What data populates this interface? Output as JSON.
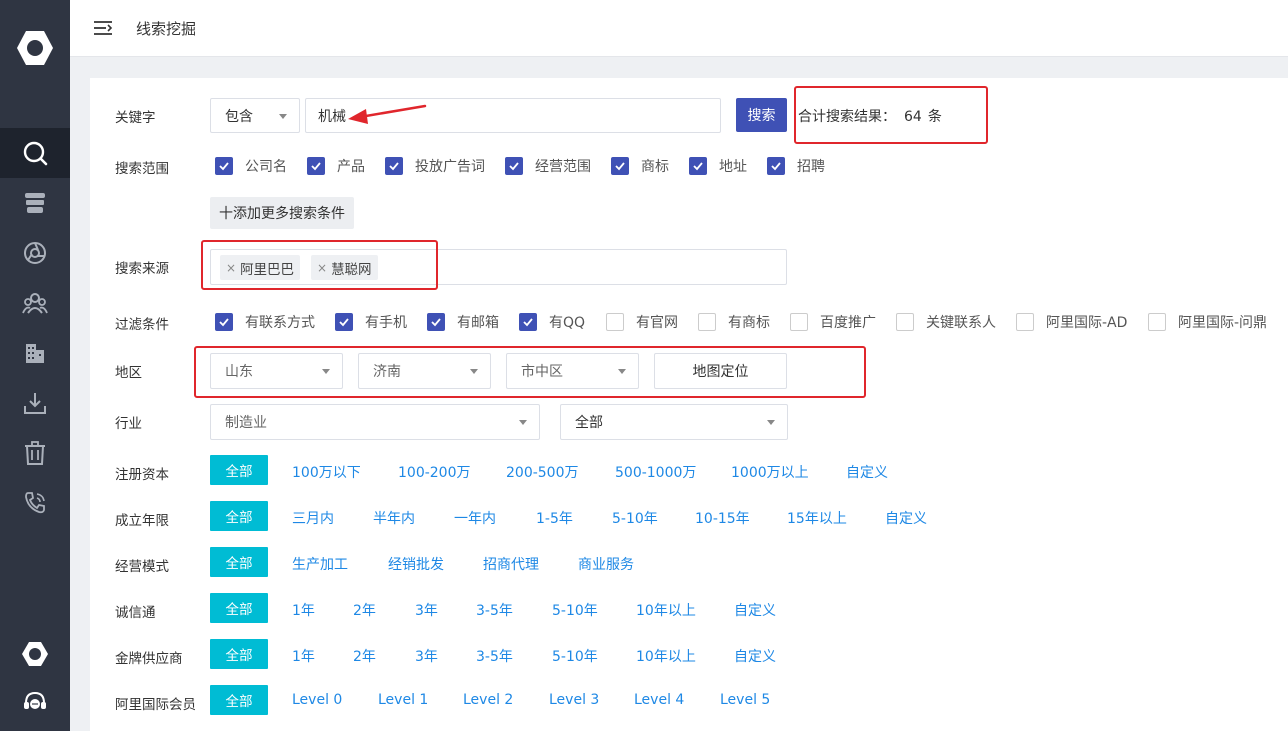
{
  "header": {
    "title": "线索挖掘"
  },
  "keyword": {
    "label": "关键字",
    "match_mode": "包含",
    "value": "机械",
    "search_label": "搜索",
    "result_prefix": "合计搜索结果：",
    "result_count": "64",
    "result_suffix": "条"
  },
  "scope": {
    "label": "搜索范围",
    "items": [
      "公司名",
      "产品",
      "投放广告词",
      "经营范围",
      "商标",
      "地址",
      "招聘"
    ],
    "add_more_label": "十添加更多搜索条件"
  },
  "source": {
    "label": "搜索来源",
    "tags": [
      "阿里巴巴",
      "慧聪网"
    ]
  },
  "filter": {
    "label": "过滤条件",
    "items": [
      "有联系方式",
      "有手机",
      "有邮箱",
      "有QQ",
      "有官网",
      "有商标",
      "百度推广",
      "关键联系人",
      "阿里国际-AD",
      "阿里国际-问鼎"
    ],
    "checked": [
      true,
      true,
      true,
      true,
      false,
      false,
      false,
      false,
      false,
      false
    ]
  },
  "region": {
    "label": "地区",
    "province": "山东",
    "city": "济南",
    "district": "市中区",
    "map_label": "地图定位"
  },
  "industry": {
    "label": "行业",
    "primary": "制造业",
    "secondary": "全部"
  },
  "capital": {
    "label": "注册资本",
    "active": "全部",
    "options": [
      "100万以下",
      "100-200万",
      "200-500万",
      "500-1000万",
      "1000万以上",
      "自定义"
    ]
  },
  "years": {
    "label": "成立年限",
    "active": "全部",
    "options": [
      "三月内",
      "半年内",
      "一年内",
      "1-5年",
      "5-10年",
      "10-15年",
      "15年以上",
      "自定义"
    ]
  },
  "mode": {
    "label": "经营模式",
    "active": "全部",
    "options": [
      "生产加工",
      "经销批发",
      "招商代理",
      "商业服务"
    ]
  },
  "chengxin": {
    "label": "诚信通",
    "active": "全部",
    "options": [
      "1年",
      "2年",
      "3年",
      "3-5年",
      "5-10年",
      "10年以上",
      "自定义"
    ]
  },
  "gold": {
    "label": "金牌供应商",
    "active": "全部",
    "options": [
      "1年",
      "2年",
      "3年",
      "3-5年",
      "5-10年",
      "10年以上",
      "自定义"
    ]
  },
  "intl": {
    "label": "阿里国际会员",
    "active": "全部",
    "options": [
      "Level 0",
      "Level 1",
      "Level 2",
      "Level 3",
      "Level 4",
      "Level 5"
    ]
  },
  "colors": {
    "sidebar": "#2f3542",
    "primary": "#3f51b5",
    "pill": "#00bcd4",
    "link": "#1e88e5",
    "highlight": "#e0262c"
  }
}
